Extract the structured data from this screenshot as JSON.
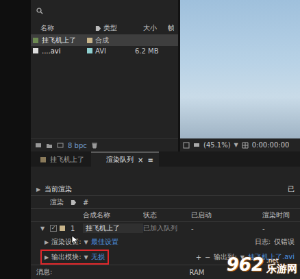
{
  "project": {
    "columns": [
      {
        "label": "名称"
      },
      {
        "label": "类型"
      },
      {
        "label": "大小"
      },
      {
        "label": "帧"
      }
    ],
    "items": [
      {
        "name": "挂飞机上了",
        "type": "合成",
        "size": "",
        "selected": true,
        "color": "#c8b48a"
      },
      {
        "name": "....avi",
        "type": "AVI",
        "size": "6.2 MB",
        "selected": false,
        "color": "#8fd0d0"
      }
    ],
    "bpc": "8 bpc"
  },
  "viewer": {
    "zoom": "(45.1%)",
    "zoom_arrow": "▼",
    "timecode": "0:00:00:00"
  },
  "tabs": [
    {
      "label": "挂飞机上了",
      "selected": false,
      "close": ""
    },
    {
      "label": "渲染队列",
      "selected": true,
      "close": "×"
    }
  ],
  "tab_menu": "≡",
  "render_queue": {
    "current": {
      "twisty": "▶",
      "label": "当前渲染",
      "right": "已"
    },
    "columns": [
      "渲染",
      "#",
      "合成名称",
      "状态",
      "已启动",
      "渲染时间"
    ],
    "items": [
      {
        "twisty": "▼",
        "checked": true,
        "color": "#c8b48a",
        "number": "1",
        "comp": "挂飞机上了",
        "status": "已加入队列",
        "started": "-",
        "time": "-"
      }
    ],
    "settings": {
      "twisty": "▶",
      "label": "渲染设置:",
      "arrow": "▼",
      "value": "最佳设置",
      "log_label": "日志:",
      "log": "仅错误"
    },
    "output": {
      "twisty": "▶",
      "label": "输出模块:",
      "arrow": "▼",
      "value": "无损",
      "highlighted": true,
      "add": "+",
      "remove": "−",
      "to_label": "输出到:",
      "to_arrow": "▼",
      "to": "挂飞机上了.avi"
    }
  },
  "status_bar": {
    "message": "消息:",
    "ram": "RAM"
  },
  "watermark": {
    "number": "962",
    "suffix": ".net",
    "site": "乐游网"
  }
}
